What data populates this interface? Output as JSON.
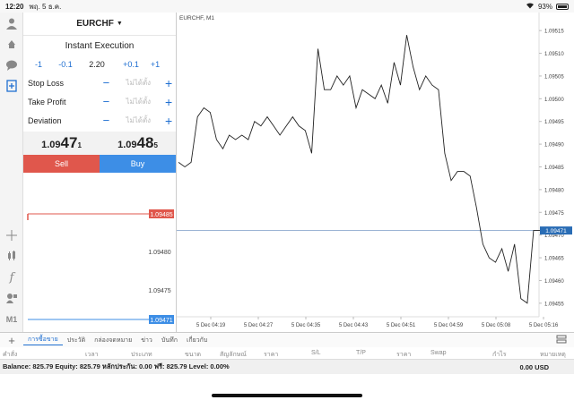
{
  "status": {
    "time": "12:20",
    "date": "พฤ. 5 ธ.ค.",
    "battery": "93%",
    "wifi_icon": "wifi-icon"
  },
  "symbol": {
    "name": "EURCHF"
  },
  "execution": {
    "mode": "Instant Execution"
  },
  "volume": {
    "minus1": "-1",
    "minus01": "-0.1",
    "value": "2.20",
    "plus01": "+0.1",
    "plus1": "+1"
  },
  "params": [
    {
      "label": "Stop Loss",
      "value": "ไม่ได้ตั้ง"
    },
    {
      "label": "Take Profit",
      "value": "ไม่ได้ตั้ง"
    },
    {
      "label": "Deviation",
      "value": "ไม่ได้ตั้ง"
    }
  ],
  "quotes": {
    "sell": {
      "prefix": "1.09",
      "big": "47",
      "sup": "1"
    },
    "buy": {
      "prefix": "1.09",
      "big": "48",
      "sup": "5"
    }
  },
  "buttons": {
    "sell": "Sell",
    "buy": "Buy"
  },
  "mini_chart": {
    "ask_label": "1.09485",
    "bid_label": "1.09471",
    "ticks": [
      "1.09480",
      "1.09475"
    ]
  },
  "chart_data": {
    "type": "line",
    "title": "EURCHF, M1",
    "x": [
      "5 Dec 04:19",
      "5 Dec 04:27",
      "5 Dec 04:35",
      "5 Dec 04:43",
      "5 Dec 04:51",
      "5 Dec 04:59",
      "5 Dec 05:08",
      "5 Dec 05:16"
    ],
    "ylim": [
      1.09453,
      1.09517
    ],
    "y_ticks": [
      "1.09515",
      "1.09510",
      "1.09505",
      "1.09500",
      "1.09495",
      "1.09490",
      "1.09485",
      "1.09480",
      "1.09475",
      "1.09470",
      "1.09465",
      "1.09460",
      "1.09455"
    ],
    "current_price_label": "1.09471",
    "current_price": 1.09471,
    "series": [
      {
        "values": [
          1.09486,
          1.09485,
          1.09486,
          1.09496,
          1.09498,
          1.09497,
          1.09491,
          1.09489,
          1.09492,
          1.09491,
          1.09492,
          1.09491,
          1.09495,
          1.09494,
          1.09496,
          1.09494,
          1.09492,
          1.09494,
          1.09496,
          1.09494,
          1.09493,
          1.09488,
          1.09511,
          1.09502,
          1.09502,
          1.09505,
          1.09503,
          1.09505,
          1.09498,
          1.09502,
          1.09501,
          1.095,
          1.09503,
          1.09499,
          1.09508,
          1.09503,
          1.09514,
          1.09507,
          1.09502,
          1.09505,
          1.09503,
          1.09502,
          1.09488,
          1.09482,
          1.09484,
          1.09484,
          1.09483,
          1.09476,
          1.09468,
          1.09465,
          1.09464,
          1.09467,
          1.09462,
          1.09468,
          1.09456,
          1.09455,
          1.09471,
          1.09471
        ]
      }
    ],
    "grid": false
  },
  "tabs": [
    "การซื้อขาย",
    "ประวัติ",
    "กล่องจดหมาย",
    "ข่าว",
    "บันทึก",
    "เกี่ยวกับ"
  ],
  "columns": [
    "คำสั่ง",
    "เวลา",
    "ประเภท",
    "ขนาด",
    "สัญลักษณ์",
    "ราคา",
    "S/L",
    "T/P",
    "ราคา",
    "Swap",
    "กำไร",
    "หมายเหตุ"
  ],
  "balance": {
    "text": "Balance: 825.79 Equity: 825.79 หลักประกัน: 0.00 ฟรี: 825.79 Level: 0.00%",
    "total": "0.00 USD"
  }
}
